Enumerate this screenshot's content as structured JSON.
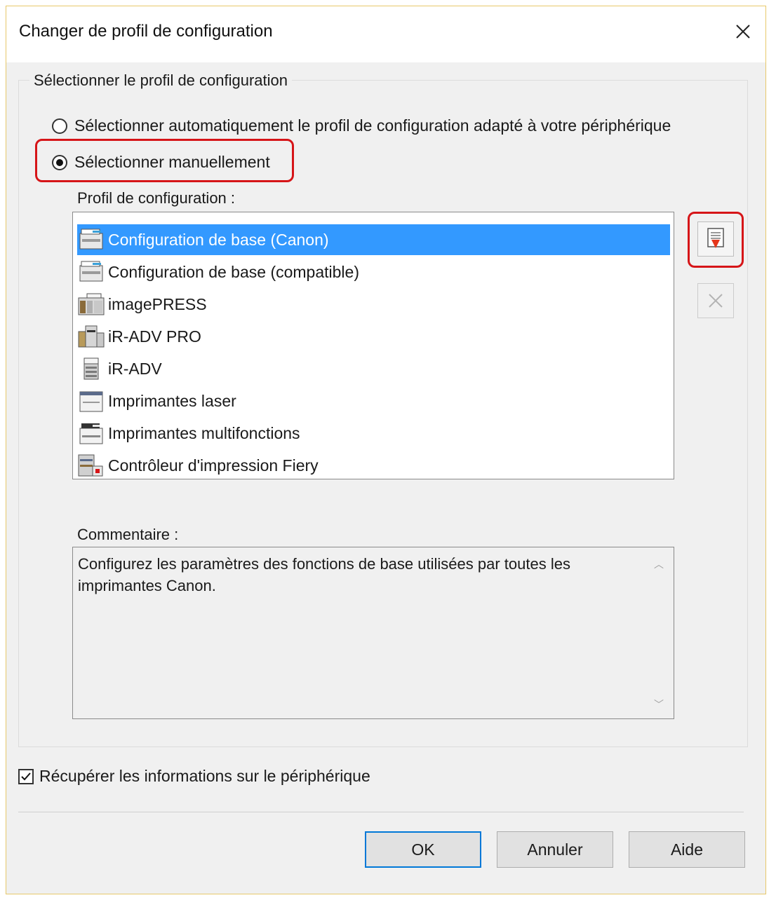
{
  "window": {
    "title": "Changer de profil de configuration",
    "close_label": "✕"
  },
  "group": {
    "legend": "Sélectionner le profil de configuration",
    "radio_auto_label": "Sélectionner automatiquement le profil de configuration adapté à votre périphérique",
    "radio_manual_label": "Sélectionner manuellement",
    "selected_option": "manual"
  },
  "profiles": {
    "label": "Profil de configuration :",
    "items": [
      {
        "label": "Configuration de base (Canon)",
        "icon": "multifunction-printer-icon",
        "selected": true
      },
      {
        "label": "Configuration de base (compatible)",
        "icon": "multifunction-printer-icon",
        "selected": false
      },
      {
        "label": "imagePRESS",
        "icon": "production-press-icon",
        "selected": false
      },
      {
        "label": "iR-ADV PRO",
        "icon": "production-printer-icon",
        "selected": false
      },
      {
        "label": "iR-ADV",
        "icon": "copier-icon",
        "selected": false
      },
      {
        "label": "Imprimantes laser",
        "icon": "laser-printer-icon",
        "selected": false
      },
      {
        "label": "Imprimantes multifonctions",
        "icon": "multifunction-printer-icon",
        "selected": false
      },
      {
        "label": "Contrôleur d'impression Fiery",
        "icon": "fiery-controller-icon",
        "selected": false
      }
    ]
  },
  "comment": {
    "label": "Commentaire :",
    "text": "Configurez les paramètres des fonctions de base utilisées par toutes les imprimantes Canon."
  },
  "device_info": {
    "label": "Récupérer les informations sur le périphérique",
    "checked": true
  },
  "buttons": {
    "ok": "OK",
    "cancel": "Annuler",
    "help": "Aide"
  },
  "colors": {
    "selection": "#3399ff",
    "highlight": "#d61518",
    "import_arrow": "#e5361b"
  }
}
